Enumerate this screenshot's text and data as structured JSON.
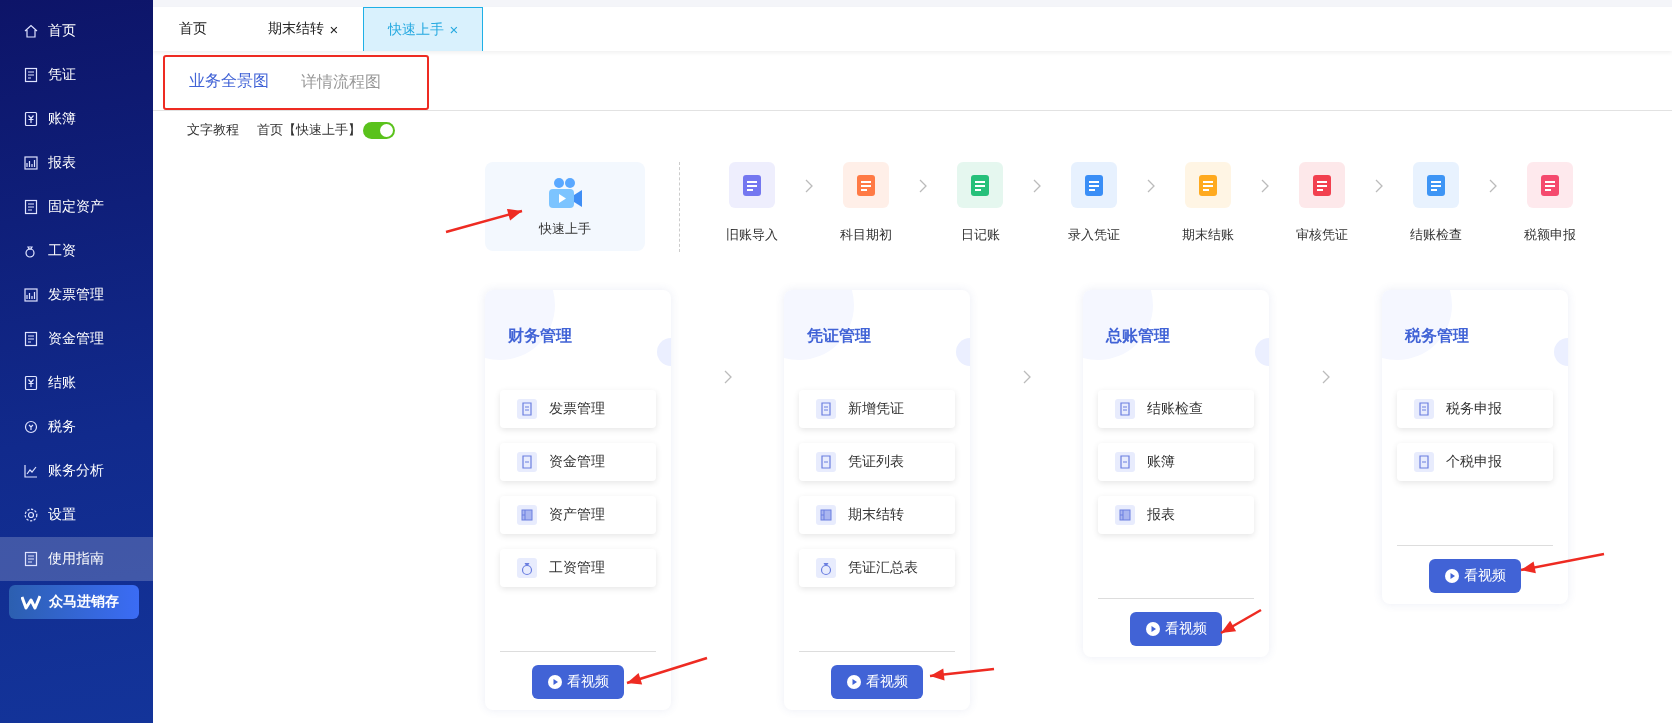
{
  "sidebar": {
    "items": [
      {
        "label": "首页",
        "selected": false
      },
      {
        "label": "凭证",
        "selected": false
      },
      {
        "label": "账簿",
        "selected": false
      },
      {
        "label": "报表",
        "selected": false
      },
      {
        "label": "固定资产",
        "selected": false
      },
      {
        "label": "工资",
        "selected": false
      },
      {
        "label": "发票管理",
        "selected": false
      },
      {
        "label": "资金管理",
        "selected": false
      },
      {
        "label": "结账",
        "selected": false
      },
      {
        "label": "税务",
        "selected": false
      },
      {
        "label": "账务分析",
        "selected": false
      },
      {
        "label": "设置",
        "selected": false
      },
      {
        "label": "使用指南",
        "selected": true
      }
    ],
    "brand_button": "众马进销存"
  },
  "tabs": [
    {
      "label": "首页",
      "closable": false,
      "selected": false
    },
    {
      "label": "期末结转",
      "closable": true,
      "selected": false
    },
    {
      "label": "快速上手",
      "closable": true,
      "selected": true
    }
  ],
  "close_glyph": "×",
  "view_tabs": [
    {
      "label": "业务全景图",
      "selected": true
    },
    {
      "label": "详情流程图",
      "selected": false
    }
  ],
  "tutorial": {
    "label": "文字教程",
    "link": "首页【快速上手】",
    "on": true
  },
  "quick_start": {
    "label": "快速上手"
  },
  "steps": [
    {
      "label": "旧账导入",
      "color": "#7477f0"
    },
    {
      "label": "科目期初",
      "color": "#ff7a45"
    },
    {
      "label": "日记账",
      "color": "#26c07a"
    },
    {
      "label": "录入凭证",
      "color": "#3a8ef6"
    },
    {
      "label": "期末结账",
      "color": "#ffaa1f"
    },
    {
      "label": "审核凭证",
      "color": "#f2404f"
    },
    {
      "label": "结账检查",
      "color": "#3e95f5"
    },
    {
      "label": "税额申报",
      "color": "#f54a6e"
    }
  ],
  "cards": [
    {
      "title": "财务管理",
      "items": [
        "发票管理",
        "资金管理",
        "资产管理",
        "工资管理"
      ],
      "button": "看视频"
    },
    {
      "title": "凭证管理",
      "items": [
        "新增凭证",
        "凭证列表",
        "期末结转",
        "凭证汇总表"
      ],
      "button": "看视频"
    },
    {
      "title": "总账管理",
      "items": [
        "结账检查",
        "账簿",
        "报表"
      ],
      "button": "看视频"
    },
    {
      "title": "税务管理",
      "items": [
        "税务申报",
        "个税申报"
      ],
      "button": "看视频"
    }
  ]
}
